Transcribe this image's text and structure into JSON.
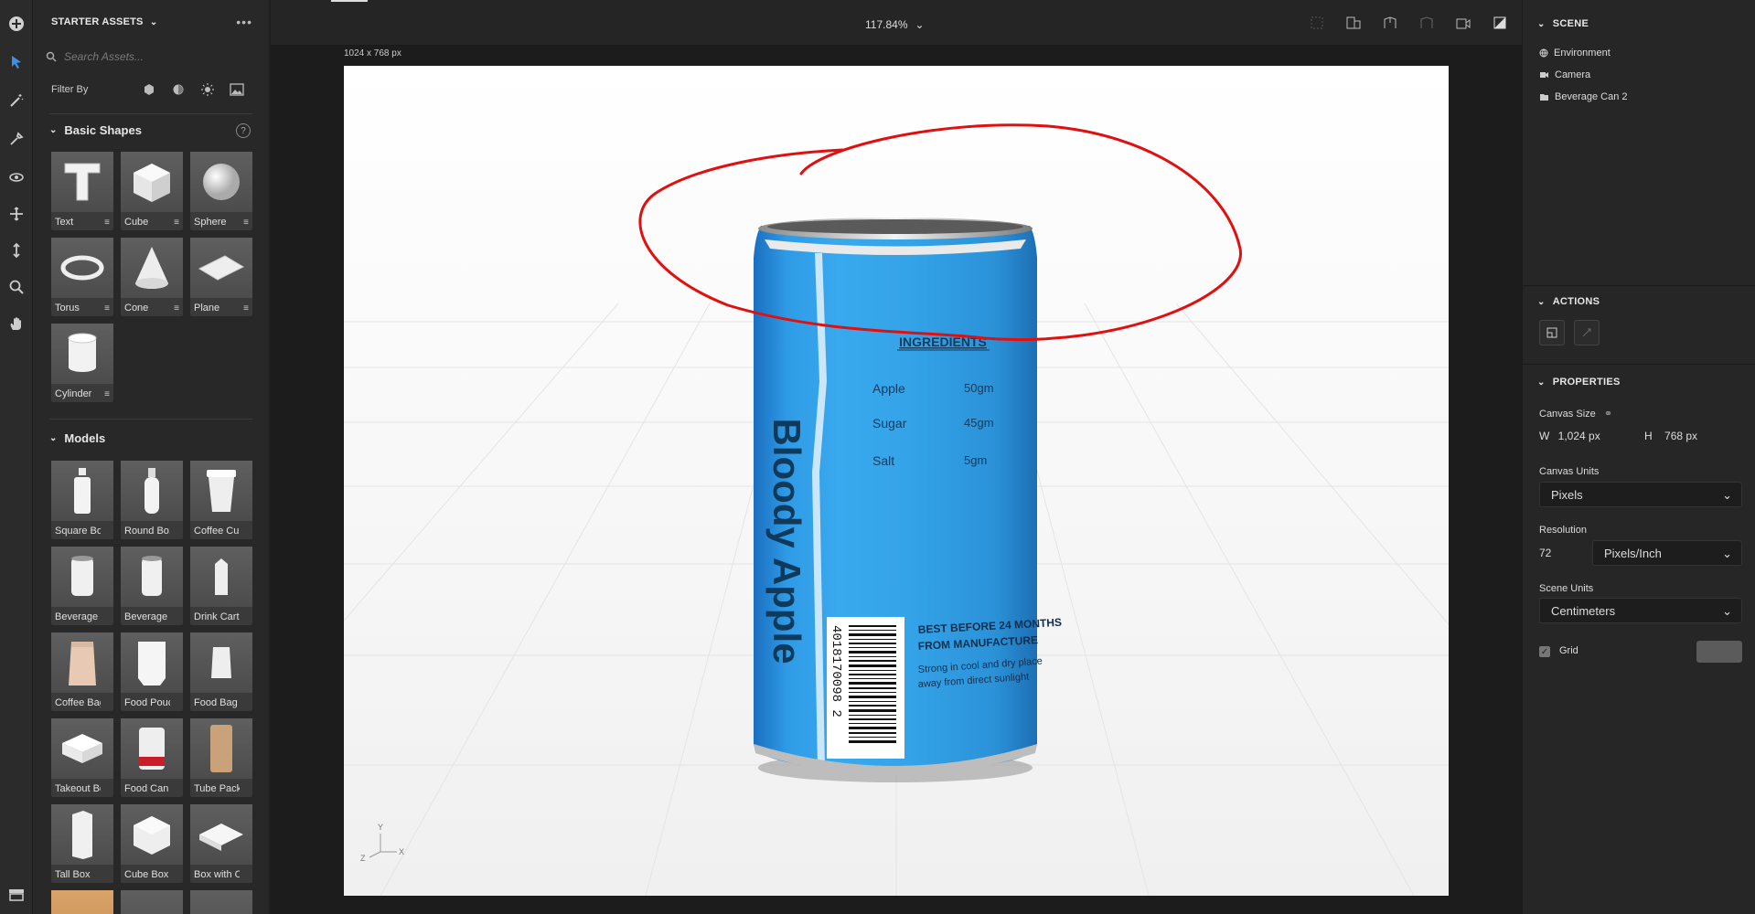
{
  "assets_panel": {
    "title": "STARTER ASSETS",
    "search_placeholder": "Search Assets...",
    "filter_label": "Filter By",
    "sections": {
      "basic_shapes": {
        "title": "Basic Shapes",
        "items": [
          "Text",
          "Cube",
          "Sphere",
          "Torus",
          "Cone",
          "Plane",
          "Cylinder"
        ]
      },
      "models": {
        "title": "Models",
        "items": [
          "Square Bo...",
          "Round Bo...",
          "Coffee Cup",
          "Beverage ...",
          "Beverage ...",
          "Drink Cart...",
          "Coffee Bag",
          "Food Pouch",
          "Food Bag",
          "Takeout Box",
          "Food Can",
          "Tube Pack...",
          "Tall Box",
          "Cube Box",
          "Box with O..."
        ]
      }
    }
  },
  "topbar": {
    "zoom": "117.84%"
  },
  "canvas": {
    "size_label": "1024 x 768 px",
    "can": {
      "brand": "Bloody Apple",
      "ingredients_title": "INGREDIENTS",
      "ingredients": [
        {
          "name": "Apple",
          "amount": "50gm"
        },
        {
          "name": "Sugar",
          "amount": "45gm"
        },
        {
          "name": "Salt",
          "amount": "5gm"
        }
      ],
      "best_before_1": "BEST BEFORE 24 MONTHS",
      "best_before_2": "FROM MANUFACTURE",
      "storage_1": "Strong in cool and dry place",
      "storage_2": "away from direct sunlight",
      "barcode": "4018170098 2",
      "can_color": "#2ea3e6"
    },
    "axis": {
      "y": "Y",
      "z": "Z",
      "x": "X"
    },
    "annotation_color": "#e01010"
  },
  "right_panel": {
    "scene": {
      "title": "SCENE",
      "items": [
        "Environment",
        "Camera",
        "Beverage Can 2"
      ]
    },
    "actions": {
      "title": "ACTIONS"
    },
    "properties": {
      "title": "PROPERTIES",
      "canvas_size_label": "Canvas Size",
      "w_label": "W",
      "w_value": "1,024 px",
      "h_label": "H",
      "h_value": "768 px",
      "canvas_units_label": "Canvas Units",
      "canvas_units_value": "Pixels",
      "resolution_label": "Resolution",
      "resolution_value": "72",
      "resolution_units": "Pixels/Inch",
      "scene_units_label": "Scene Units",
      "scene_units_value": "Centimeters",
      "grid_label": "Grid"
    }
  }
}
